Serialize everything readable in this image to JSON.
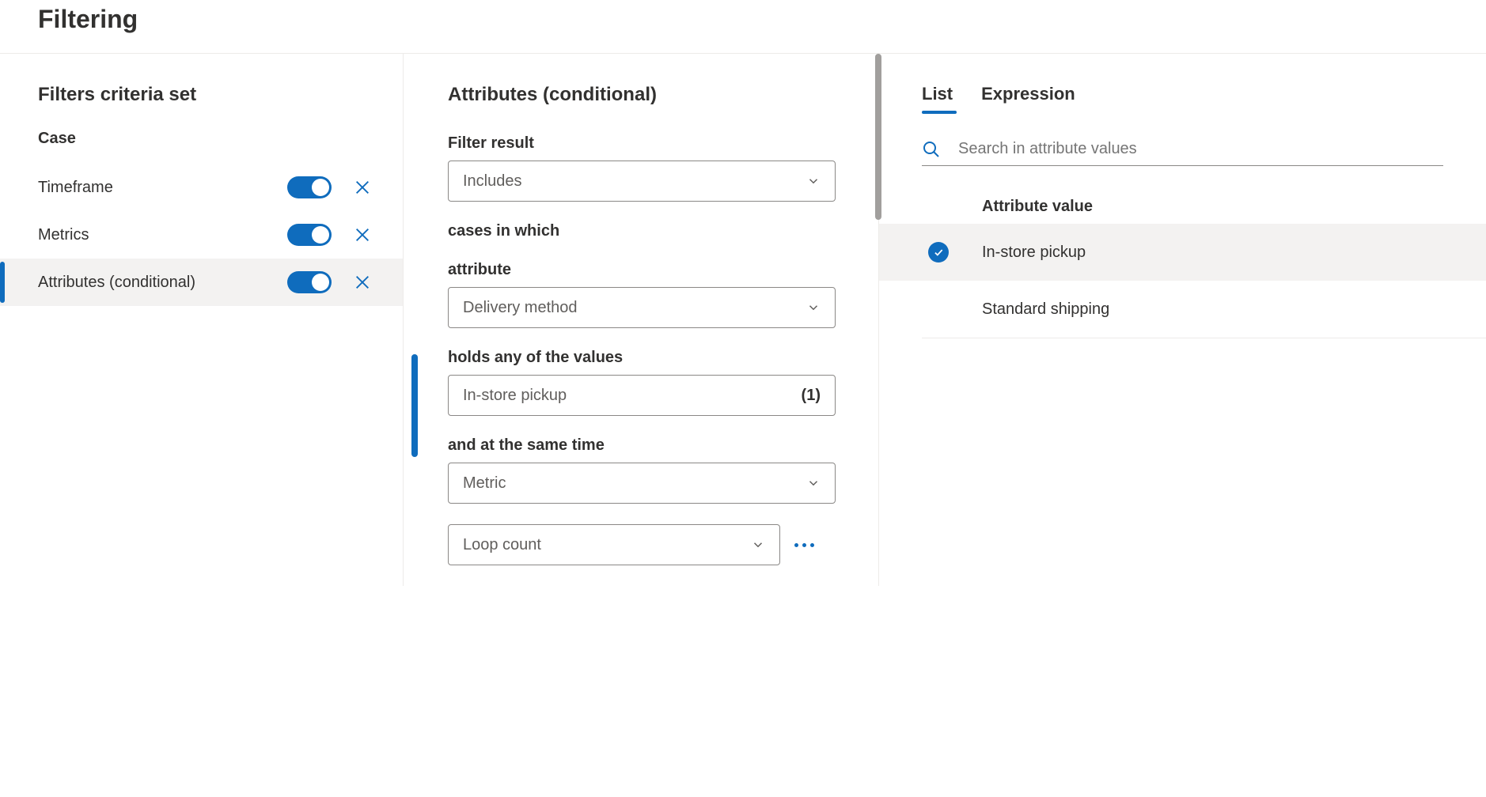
{
  "header": {
    "title": "Filtering"
  },
  "left": {
    "title": "Filters criteria set",
    "group": "Case",
    "items": [
      {
        "label": "Timeframe",
        "enabled": true,
        "selected": false
      },
      {
        "label": "Metrics",
        "enabled": true,
        "selected": false
      },
      {
        "label": "Attributes (conditional)",
        "enabled": true,
        "selected": true
      }
    ]
  },
  "mid": {
    "title": "Attributes (conditional)",
    "filter_result_label": "Filter result",
    "filter_result_value": "Includes",
    "cases_label": "cases in which",
    "attribute_label": "attribute",
    "attribute_value": "Delivery method",
    "holds_label": "holds any of the values",
    "holds_value": "In-store pickup",
    "holds_count": "(1)",
    "sametime_label": "and at the same time",
    "sametime_value": "Metric",
    "extra_value": "Loop count"
  },
  "right": {
    "tabs": {
      "list": "List",
      "expression": "Expression",
      "active": "list"
    },
    "search_placeholder": "Search in attribute values",
    "attr_header": "Attribute value",
    "values": [
      {
        "label": "In-store pickup",
        "checked": true
      },
      {
        "label": "Standard shipping",
        "checked": false
      }
    ]
  }
}
